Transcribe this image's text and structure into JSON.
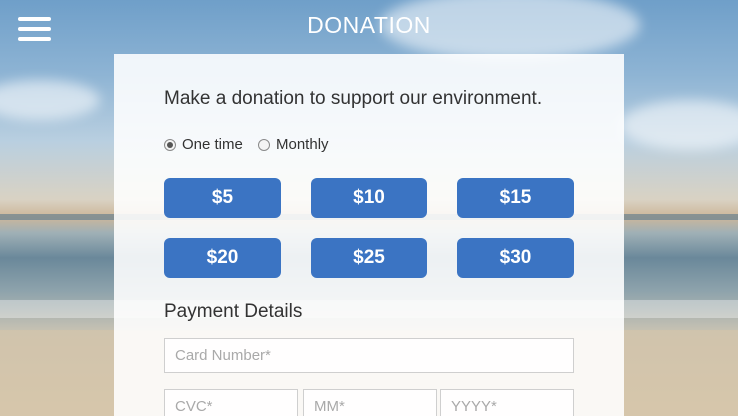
{
  "header": {
    "title": "DONATION",
    "menu_icon": "hamburger-menu-icon"
  },
  "donation_form": {
    "headline": "Make a donation to support our environment.",
    "frequency": {
      "options": [
        {
          "label": "One time",
          "selected": true
        },
        {
          "label": "Monthly",
          "selected": false
        }
      ]
    },
    "amounts": [
      "$5",
      "$10",
      "$15",
      "$20",
      "$25",
      "$30"
    ],
    "payment": {
      "section_title": "Payment Details",
      "card_number_placeholder": "Card Number*",
      "cvc_placeholder": "CVC*",
      "month_placeholder": "MM*",
      "year_placeholder": "YYYY*"
    }
  },
  "colors": {
    "button_blue": "#3b74c3",
    "card_background": "#ffffff",
    "text": "#333333"
  }
}
